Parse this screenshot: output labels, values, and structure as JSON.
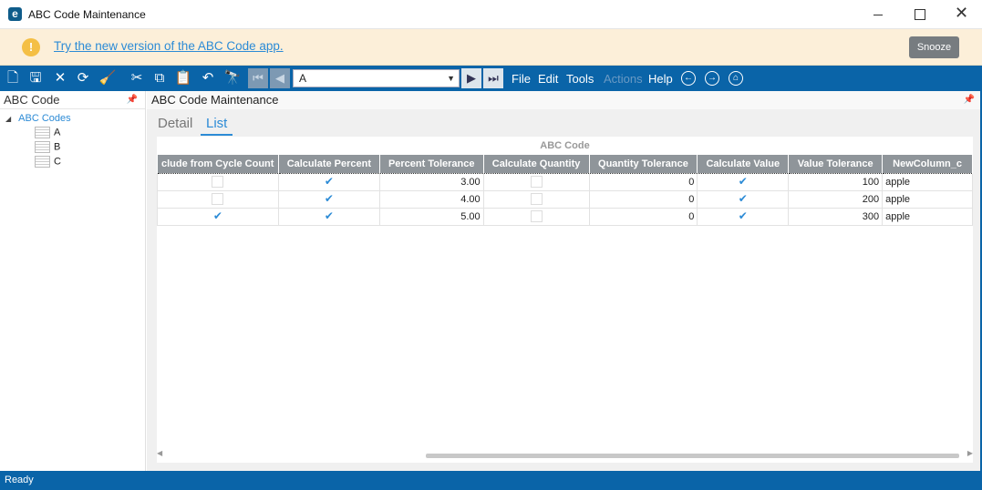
{
  "window": {
    "title": "ABC Code Maintenance",
    "logo": "e",
    "close_glyph": "✕"
  },
  "banner": {
    "warn_glyph": "!",
    "link_text": "Try the new version of the ABC Code app.",
    "snooze_label": "Snooze"
  },
  "toolbar": {
    "selected_code": "A",
    "menus": [
      "File",
      "Edit",
      "Tools",
      "Actions",
      "Help"
    ],
    "icons": {
      "new": "🗋",
      "save": "🖫",
      "delete": "✕",
      "refresh": "⟳",
      "clear": "🧹",
      "cut": "✂",
      "copy": "⧉",
      "paste": "📋",
      "undo": "↶",
      "search": "🔭",
      "first": "⏮",
      "prev": "◀",
      "next": "▶",
      "last": "⏭",
      "back": "←",
      "forward": "→",
      "home": "⌂",
      "dropdown": "▼"
    }
  },
  "left_panel": {
    "title": "ABC Code",
    "pin": "📌",
    "tree_root": "ABC Codes",
    "tree_toggle": "◢",
    "tree_items": [
      "A",
      "B",
      "C"
    ]
  },
  "main_panel": {
    "title": "ABC Code Maintenance",
    "pin": "📌",
    "tabs": [
      "Detail",
      "List"
    ],
    "grid": {
      "group_title": "ABC Code",
      "columns": [
        "clude from Cycle Count",
        "Calculate Percent",
        "Percent Tolerance",
        "Calculate Quantity",
        "Quantity Tolerance",
        "Calculate Value",
        "Value Tolerance",
        "NewColumn_c"
      ],
      "rows": [
        {
          "exclude": false,
          "calc_percent": true,
          "percent_tol": "3.00",
          "calc_qty": false,
          "qty_tol": "0",
          "calc_value": true,
          "value_tol": "100",
          "new_col": "apple"
        },
        {
          "exclude": false,
          "calc_percent": true,
          "percent_tol": "4.00",
          "calc_qty": false,
          "qty_tol": "0",
          "calc_value": true,
          "value_tol": "200",
          "new_col": "apple"
        },
        {
          "exclude": true,
          "calc_percent": true,
          "percent_tol": "5.00",
          "calc_qty": false,
          "qty_tol": "0",
          "calc_value": true,
          "value_tol": "300",
          "new_col": "apple"
        }
      ],
      "check_glyph": "✔",
      "scroll_left": "◀",
      "scroll_right": "▶"
    }
  },
  "status": {
    "text": "Ready"
  }
}
